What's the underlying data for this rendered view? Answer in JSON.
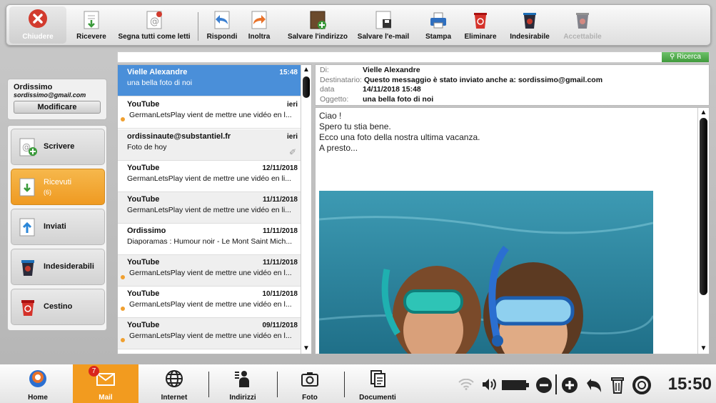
{
  "toolbar": {
    "close_label": "Chiudere",
    "buttons": [
      "Ricevere",
      "Segna tutti come letti",
      "Rispondi",
      "Inoltra",
      "Salvare l'indirizzo",
      "Salvare l'e-mail",
      "Stampa",
      "Eliminare",
      "Indesirabile",
      "Accettabile"
    ]
  },
  "search": {
    "button_label": "Ricerca"
  },
  "account": {
    "name": "Ordissimo",
    "email": "sordissimo@gmail.com",
    "modify_label": "Modificare"
  },
  "folders": [
    {
      "label": "Scrivere",
      "count": ""
    },
    {
      "label": "Ricevuti",
      "count": "(6)"
    },
    {
      "label": "Inviati",
      "count": ""
    },
    {
      "label": "Indesiderabili",
      "count": ""
    },
    {
      "label": "Cestino",
      "count": ""
    }
  ],
  "messages": [
    {
      "sender": "Vielle Alexandre",
      "date": "15:48",
      "subject": "una bella foto di noi"
    },
    {
      "sender": "YouTube",
      "date": "ieri",
      "subject": "GermanLetsPlay vient de mettre une vidéo en l..."
    },
    {
      "sender": "ordissinaute@substantiel.fr",
      "date": "ieri",
      "subject": "Foto de hoy"
    },
    {
      "sender": "YouTube",
      "date": "12/11/2018",
      "subject": "GermanLetsPlay vient de mettre une vidéo en li..."
    },
    {
      "sender": "YouTube",
      "date": "11/11/2018",
      "subject": "GermanLetsPlay vient de mettre une vidéo en li..."
    },
    {
      "sender": "Ordissimo",
      "date": "11/11/2018",
      "subject": "Diaporamas : Humour noir - Le Mont Saint Mich..."
    },
    {
      "sender": "YouTube",
      "date": "11/11/2018",
      "subject": "GermanLetsPlay vient de mettre une vidéo en l..."
    },
    {
      "sender": "YouTube",
      "date": "10/11/2018",
      "subject": "GermanLetsPlay vient de mettre une vidéo en l..."
    },
    {
      "sender": "YouTube",
      "date": "09/11/2018",
      "subject": "GermanLetsPlay vient de mettre une vidéo en l..."
    }
  ],
  "header": {
    "from_key": "Di:",
    "from": "Vielle Alexandre",
    "to_key": "Destinatario:",
    "to": "Questo messaggio è stato inviato anche a: sordissimo@gmail.com",
    "date_key": "data",
    "date": "14/11/2018 15:48",
    "subject_key": "Oggetto:",
    "subject": "una bella foto di noi"
  },
  "body": {
    "line1": "Ciao !",
    "line2": "Spero tu stia bene.",
    "line3": "Ecco una foto della nostra ultima vacanza.",
    "line4": "A presto..."
  },
  "dock": {
    "items": [
      "Home",
      "Mail",
      "Internet",
      "Indirizzi",
      "Foto",
      "Documenti"
    ],
    "mail_badge": "7",
    "clock": "15:50"
  }
}
